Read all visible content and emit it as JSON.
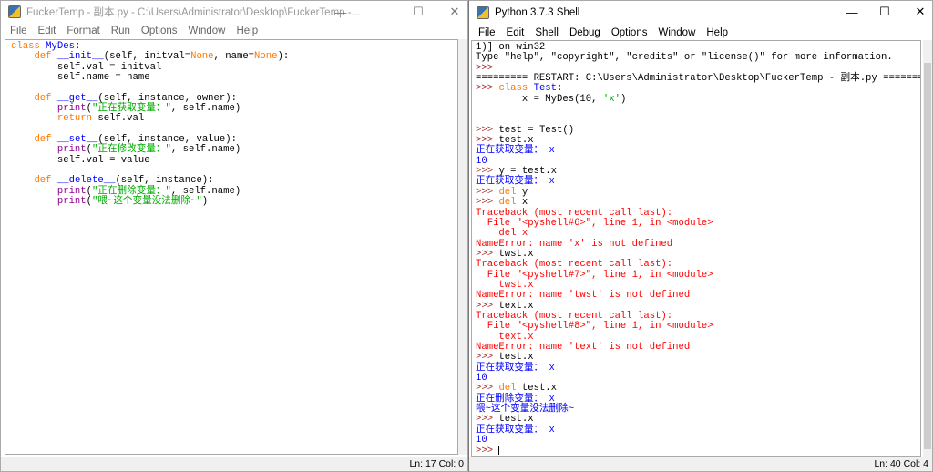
{
  "editor": {
    "title": "FuckerTemp - 副本.py - C:\\Users\\Administrator\\Desktop\\FuckerTemp -...",
    "menu": [
      "File",
      "Edit",
      "Format",
      "Run",
      "Options",
      "Window",
      "Help"
    ],
    "lines": [
      [
        [
          "class ",
          "kw"
        ],
        [
          "MyDes",
          "def"
        ],
        [
          ":",
          "tx"
        ]
      ],
      [
        [
          "    ",
          "tx"
        ],
        [
          "def ",
          "kw"
        ],
        [
          "__init__",
          "def"
        ],
        [
          "(self, initval=",
          "tx"
        ],
        [
          "None",
          "kw"
        ],
        [
          ", name=",
          "tx"
        ],
        [
          "None",
          "kw"
        ],
        [
          "):",
          "tx"
        ]
      ],
      [
        [
          "        self.val = initval",
          "tx"
        ]
      ],
      [
        [
          "        self.name = name",
          "tx"
        ]
      ],
      [
        [
          "",
          "tx"
        ]
      ],
      [
        [
          "    ",
          "tx"
        ],
        [
          "def ",
          "kw"
        ],
        [
          "__get__",
          "def"
        ],
        [
          "(self, instance, owner):",
          "tx"
        ]
      ],
      [
        [
          "        ",
          "tx"
        ],
        [
          "print",
          "bi"
        ],
        [
          "(",
          "tx"
        ],
        [
          "\"正在获取变量：\"",
          "str"
        ],
        [
          ", self.name)",
          "tx"
        ]
      ],
      [
        [
          "        ",
          "tx"
        ],
        [
          "return ",
          "kw"
        ],
        [
          "self.val",
          "tx"
        ]
      ],
      [
        [
          "",
          "tx"
        ]
      ],
      [
        [
          "    ",
          "tx"
        ],
        [
          "def ",
          "kw"
        ],
        [
          "__set__",
          "def"
        ],
        [
          "(self, instance, value):",
          "tx"
        ]
      ],
      [
        [
          "        ",
          "tx"
        ],
        [
          "print",
          "bi"
        ],
        [
          "(",
          "tx"
        ],
        [
          "\"正在修改变量：\"",
          "str"
        ],
        [
          ", self.name)",
          "tx"
        ]
      ],
      [
        [
          "        self.val = value",
          "tx"
        ]
      ],
      [
        [
          "",
          "tx"
        ]
      ],
      [
        [
          "    ",
          "tx"
        ],
        [
          "def ",
          "kw"
        ],
        [
          "__delete__",
          "def"
        ],
        [
          "(self, instance):",
          "tx"
        ]
      ],
      [
        [
          "        ",
          "tx"
        ],
        [
          "print",
          "bi"
        ],
        [
          "(",
          "tx"
        ],
        [
          "\"正在删除变量：\"",
          "str"
        ],
        [
          ", self.name)",
          "tx"
        ]
      ],
      [
        [
          "        ",
          "tx"
        ],
        [
          "print",
          "bi"
        ],
        [
          "(",
          "tx"
        ],
        [
          "\"喂~这个变量没法删除~\"",
          "str"
        ],
        [
          ")",
          "tx"
        ]
      ]
    ],
    "status": "Ln: 17  Col: 0"
  },
  "shell": {
    "title": "Python 3.7.3 Shell",
    "menu": [
      "File",
      "Edit",
      "Shell",
      "Debug",
      "Options",
      "Window",
      "Help"
    ],
    "lines": [
      [
        [
          "1)] on win32",
          "tx"
        ]
      ],
      [
        [
          "Type \"help\", \"copyright\", \"credits\" or \"license()\" for more information.",
          "tx"
        ]
      ],
      [
        [
          ">>> ",
          "pr"
        ]
      ],
      [
        [
          "========= RESTART: C:\\Users\\Administrator\\Desktop\\FuckerTemp - 副本.py =========",
          "tx"
        ]
      ],
      [
        [
          ">>> ",
          "pr"
        ],
        [
          "class ",
          "kw"
        ],
        [
          "Test",
          "def"
        ],
        [
          ":",
          "tx"
        ]
      ],
      [
        [
          "        x = MyDes(10, ",
          "tx"
        ],
        [
          "'x'",
          "str"
        ],
        [
          ")",
          "tx"
        ]
      ],
      [
        [
          "",
          "tx"
        ]
      ],
      [
        [
          "",
          "tx"
        ]
      ],
      [
        [
          ">>> ",
          "pr"
        ],
        [
          "test = Test()",
          "tx"
        ]
      ],
      [
        [
          ">>> ",
          "pr"
        ],
        [
          "test.x",
          "tx"
        ]
      ],
      [
        [
          "正在获取变量： x",
          "out"
        ]
      ],
      [
        [
          "10",
          "out"
        ]
      ],
      [
        [
          ">>> ",
          "pr"
        ],
        [
          "y = test.x",
          "tx"
        ]
      ],
      [
        [
          "正在获取变量： x",
          "out"
        ]
      ],
      [
        [
          ">>> ",
          "pr"
        ],
        [
          "del ",
          "kw"
        ],
        [
          "y",
          "tx"
        ]
      ],
      [
        [
          ">>> ",
          "pr"
        ],
        [
          "del ",
          "kw"
        ],
        [
          "x",
          "tx"
        ]
      ],
      [
        [
          "Traceback (most recent call last):",
          "err"
        ]
      ],
      [
        [
          "  File \"<pyshell#6>\", line 1, in <module>",
          "err"
        ]
      ],
      [
        [
          "    del x",
          "err"
        ]
      ],
      [
        [
          "NameError: name 'x' is not defined",
          "err"
        ]
      ],
      [
        [
          ">>> ",
          "pr"
        ],
        [
          "twst.x",
          "tx"
        ]
      ],
      [
        [
          "Traceback (most recent call last):",
          "err"
        ]
      ],
      [
        [
          "  File \"<pyshell#7>\", line 1, in <module>",
          "err"
        ]
      ],
      [
        [
          "    twst.x",
          "err"
        ]
      ],
      [
        [
          "NameError: name 'twst' is not defined",
          "err"
        ]
      ],
      [
        [
          ">>> ",
          "pr"
        ],
        [
          "text.x",
          "tx"
        ]
      ],
      [
        [
          "Traceback (most recent call last):",
          "err"
        ]
      ],
      [
        [
          "  File \"<pyshell#8>\", line 1, in <module>",
          "err"
        ]
      ],
      [
        [
          "    text.x",
          "err"
        ]
      ],
      [
        [
          "NameError: name 'text' is not defined",
          "err"
        ]
      ],
      [
        [
          ">>> ",
          "pr"
        ],
        [
          "test.x",
          "tx"
        ]
      ],
      [
        [
          "正在获取变量： x",
          "out"
        ]
      ],
      [
        [
          "10",
          "out"
        ]
      ],
      [
        [
          ">>> ",
          "pr"
        ],
        [
          "del ",
          "kw"
        ],
        [
          "test.x",
          "tx"
        ]
      ],
      [
        [
          "正在删除变量： x",
          "out"
        ]
      ],
      [
        [
          "喂~这个变量没法删除~",
          "out"
        ]
      ],
      [
        [
          ">>> ",
          "pr"
        ],
        [
          "test.x",
          "tx"
        ]
      ],
      [
        [
          "正在获取变量： x",
          "out"
        ]
      ],
      [
        [
          "10",
          "out"
        ]
      ],
      [
        [
          ">>> ",
          "pr"
        ]
      ]
    ],
    "status": "Ln: 40  Col: 4"
  }
}
